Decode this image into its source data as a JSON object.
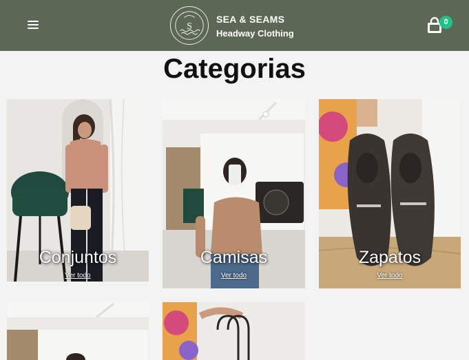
{
  "header": {
    "brand_name": "SEA & SEAMS",
    "brand_tagline": "Headway Clothing",
    "logo_letter": "S",
    "logo_ring_text": "SEA & SEAMS",
    "cart_count": "0",
    "color": "#5d6755",
    "badge_color": "#1fc38a"
  },
  "main": {
    "title": "Categorias",
    "categories": [
      {
        "name": "Conjuntos",
        "link": "Ver todo"
      },
      {
        "name": "Camisas",
        "link": "Ver todo"
      },
      {
        "name": "Zapatos",
        "link": "Ver todo"
      },
      {
        "name": "",
        "link": ""
      },
      {
        "name": "",
        "link": ""
      }
    ]
  }
}
